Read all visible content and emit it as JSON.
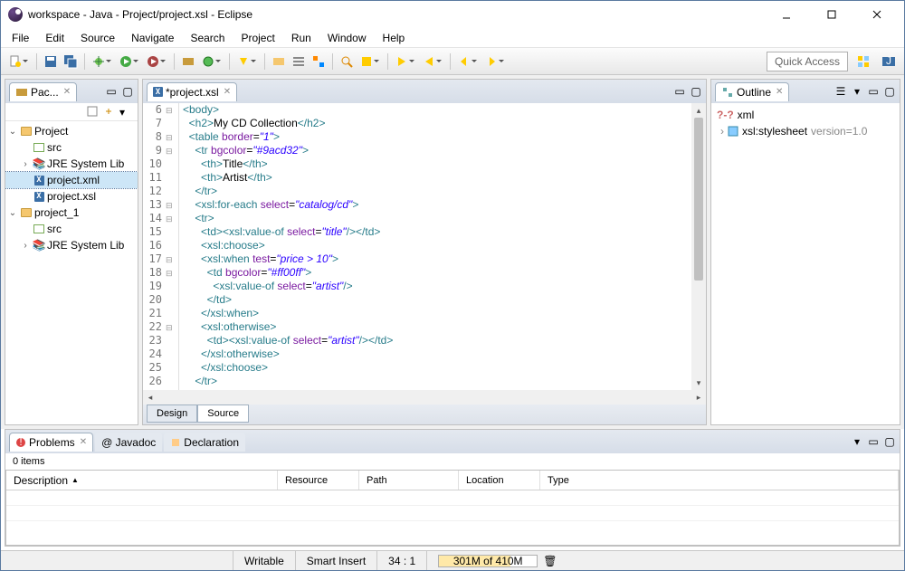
{
  "window": {
    "title": "workspace - Java - Project/project.xsl - Eclipse"
  },
  "menu": [
    "File",
    "Edit",
    "Source",
    "Navigate",
    "Search",
    "Project",
    "Run",
    "Window",
    "Help"
  ],
  "toolbar": {
    "quick_access": "Quick Access"
  },
  "left": {
    "tab": "Pac...",
    "tree": {
      "project": "Project",
      "src": "src",
      "jre": "JRE System Lib",
      "xml": "project.xml",
      "xsl": "project.xsl",
      "project1": "project_1",
      "src1": "src",
      "jre1": "JRE System Lib"
    }
  },
  "editor": {
    "tab": "*project.xsl",
    "gutter_start": 6,
    "folds": {
      "6": "-",
      "8": "-",
      "9": "-",
      "13": "-",
      "14": "-",
      "17": "-",
      "18": "-",
      "22": "-"
    },
    "lines": [
      [
        [
          "tag",
          "<body>"
        ]
      ],
      [
        [
          "text",
          "  "
        ],
        [
          "tag",
          "<h2>"
        ],
        [
          "text",
          "My CD Collection"
        ],
        [
          "tag",
          "</h2>"
        ]
      ],
      [
        [
          "text",
          "  "
        ],
        [
          "tag",
          "<table"
        ],
        [
          "text",
          " "
        ],
        [
          "attr",
          "border"
        ],
        [
          "text",
          "="
        ],
        [
          "val",
          "\"1\""
        ],
        [
          "tag",
          ">"
        ]
      ],
      [
        [
          "text",
          "    "
        ],
        [
          "tag",
          "<tr"
        ],
        [
          "text",
          " "
        ],
        [
          "attr",
          "bgcolor"
        ],
        [
          "text",
          "="
        ],
        [
          "val",
          "\"#9acd32\""
        ],
        [
          "tag",
          ">"
        ]
      ],
      [
        [
          "text",
          "      "
        ],
        [
          "tag",
          "<th>"
        ],
        [
          "text",
          "Title"
        ],
        [
          "tag",
          "</th>"
        ]
      ],
      [
        [
          "text",
          "      "
        ],
        [
          "tag",
          "<th>"
        ],
        [
          "text",
          "Artist"
        ],
        [
          "tag",
          "</th>"
        ]
      ],
      [
        [
          "text",
          "    "
        ],
        [
          "tag",
          "</tr>"
        ]
      ],
      [
        [
          "text",
          "    "
        ],
        [
          "tag",
          "<xsl:for-each"
        ],
        [
          "text",
          " "
        ],
        [
          "attr",
          "select"
        ],
        [
          "text",
          "="
        ],
        [
          "val",
          "\"catalog/cd\""
        ],
        [
          "tag",
          ">"
        ]
      ],
      [
        [
          "text",
          "    "
        ],
        [
          "tag",
          "<tr>"
        ]
      ],
      [
        [
          "text",
          "      "
        ],
        [
          "tag",
          "<td><xsl:value-of"
        ],
        [
          "text",
          " "
        ],
        [
          "attr",
          "select"
        ],
        [
          "text",
          "="
        ],
        [
          "val",
          "\"title\""
        ],
        [
          "tag",
          "/></td>"
        ]
      ],
      [
        [
          "text",
          "      "
        ],
        [
          "tag",
          "<xsl:choose>"
        ]
      ],
      [
        [
          "text",
          "      "
        ],
        [
          "tag",
          "<xsl:when"
        ],
        [
          "text",
          " "
        ],
        [
          "attr",
          "test"
        ],
        [
          "text",
          "="
        ],
        [
          "val",
          "\"price > 10\""
        ],
        [
          "tag",
          ">"
        ]
      ],
      [
        [
          "text",
          "        "
        ],
        [
          "tag",
          "<td"
        ],
        [
          "text",
          " "
        ],
        [
          "attr",
          "bgcolor"
        ],
        [
          "text",
          "="
        ],
        [
          "val",
          "\"#ff00ff\""
        ],
        [
          "tag",
          ">"
        ]
      ],
      [
        [
          "text",
          "          "
        ],
        [
          "tag",
          "<xsl:value-of"
        ],
        [
          "text",
          " "
        ],
        [
          "attr",
          "select"
        ],
        [
          "text",
          "="
        ],
        [
          "val",
          "\"artist\""
        ],
        [
          "tag",
          "/>"
        ]
      ],
      [
        [
          "text",
          "        "
        ],
        [
          "tag",
          "</td>"
        ]
      ],
      [
        [
          "text",
          "      "
        ],
        [
          "tag",
          "</xsl:when>"
        ]
      ],
      [
        [
          "text",
          "      "
        ],
        [
          "tag",
          "<xsl:otherwise>"
        ]
      ],
      [
        [
          "text",
          "        "
        ],
        [
          "tag",
          "<td><xsl:value-of"
        ],
        [
          "text",
          " "
        ],
        [
          "attr",
          "select"
        ],
        [
          "text",
          "="
        ],
        [
          "val",
          "\"artist\""
        ],
        [
          "tag",
          "/></td>"
        ]
      ],
      [
        [
          "text",
          "      "
        ],
        [
          "tag",
          "</xsl:otherwise>"
        ]
      ],
      [
        [
          "text",
          "      "
        ],
        [
          "tag",
          "</xsl:choose>"
        ]
      ],
      [
        [
          "text",
          "    "
        ],
        [
          "tag",
          "</tr>"
        ]
      ]
    ],
    "bottom_tabs": {
      "design": "Design",
      "source": "Source"
    }
  },
  "outline": {
    "tab": "Outline",
    "root": "xml",
    "child": "xsl:stylesheet",
    "child_attr": "version=1.0"
  },
  "problems": {
    "tabs": {
      "problems": "Problems",
      "javadoc": "@ Javadoc",
      "declaration": "Declaration"
    },
    "count": "0 items",
    "cols": [
      "Description",
      "Resource",
      "Path",
      "Location",
      "Type"
    ]
  },
  "status": {
    "writable": "Writable",
    "insert": "Smart Insert",
    "pos": "34 : 1",
    "mem": "301M of 410M"
  }
}
